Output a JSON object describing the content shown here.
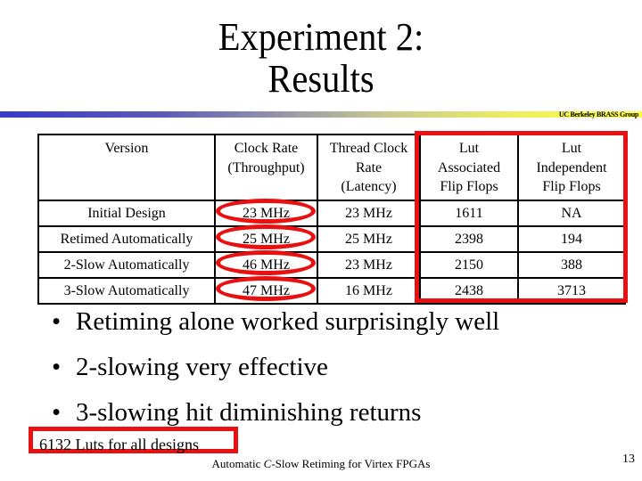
{
  "slide": {
    "title_line1": "Experiment 2:",
    "title_line2": "Results",
    "group_label": "UC Berkeley BRASS Group",
    "accent_color": "#e81010",
    "table": {
      "headers": [
        [
          "Version"
        ],
        [
          "Clock Rate",
          "(Throughput)"
        ],
        [
          "Thread Clock",
          "Rate",
          "(Latency)"
        ],
        [
          "Lut",
          "Associated",
          "Flip Flops"
        ],
        [
          "Lut",
          "Independent",
          "Flip Flops"
        ]
      ],
      "rows": [
        [
          "Initial Design",
          "23 MHz",
          "23 MHz",
          "1611",
          "NA"
        ],
        [
          "Retimed Automatically",
          "25 MHz",
          "25 MHz",
          "2398",
          "194"
        ],
        [
          "2-Slow Automatically",
          "46 MHz",
          "23 MHz",
          "2150",
          "388"
        ],
        [
          "3-Slow Automatically",
          "47 MHz",
          "16 MHz",
          "2438",
          "3713"
        ]
      ]
    },
    "bullets": [
      "Retiming alone worked surprisingly well",
      "2-slowing very effective",
      "3-slowing hit diminishing returns"
    ],
    "bullet_glyph": "•",
    "note": "6132 Luts for all designs",
    "footer_prefix": "Automatic ",
    "footer_italic": "C",
    "footer_suffix": "-Slow Retiming for Virtex FPGAs",
    "page_number": "13"
  }
}
